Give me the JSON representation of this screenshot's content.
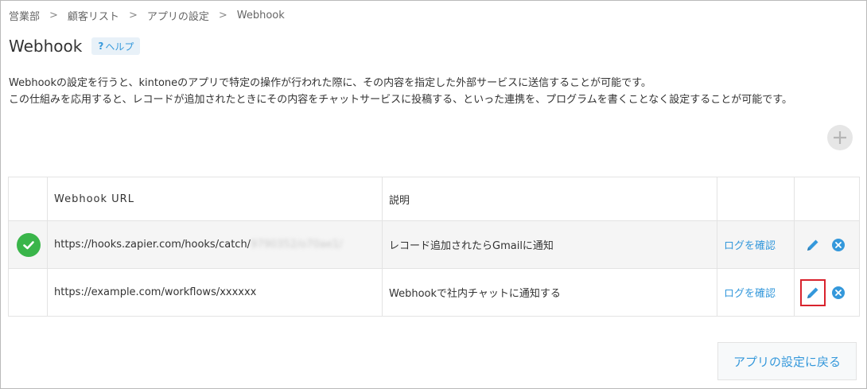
{
  "breadcrumb": {
    "items": [
      "営業部",
      "顧客リスト",
      "アプリの設定",
      "Webhook"
    ],
    "separator": ">"
  },
  "header": {
    "title": "Webhook",
    "help_mark": "?",
    "help_label": "ヘルプ"
  },
  "description": {
    "line1": "Webhookの設定を行うと、kintoneのアプリで特定の操作が行われた際に、その内容を指定した外部サービスに送信することが可能です。",
    "line2": "この仕組みを応用すると、レコードが追加されたときにその内容をチャットサービスに投稿する、といった連携を、プログラムを書くことなく設定することが可能です。"
  },
  "table": {
    "columns": {
      "url": "Webhook URL",
      "description": "説明"
    },
    "rows": [
      {
        "enabled": true,
        "url": "https://hooks.zapier.com/hooks/catch/",
        "url_hidden": "9790352/o70ae1/",
        "description": "レコード追加されたらGmailに通知",
        "log_label": "ログを確認",
        "edit_highlighted": false
      },
      {
        "enabled": false,
        "url": "https://example.com/workflows/xxxxxx",
        "url_hidden": "",
        "description": "Webhookで社内チャットに通知する",
        "log_label": "ログを確認",
        "edit_highlighted": true
      }
    ]
  },
  "footer": {
    "back_label": "アプリの設定に戻る"
  },
  "colors": {
    "accent": "#3498db",
    "enabled_green": "#3ab54a",
    "highlight_red": "#d9232d"
  }
}
